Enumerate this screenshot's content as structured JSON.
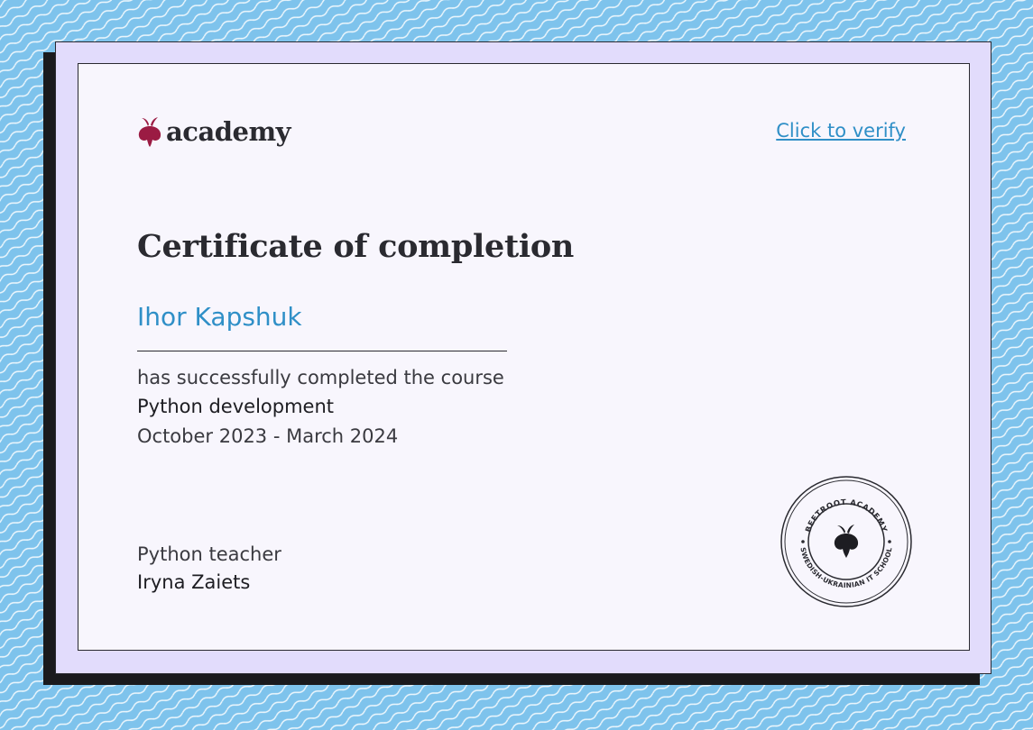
{
  "header": {
    "logo_text": "academy",
    "logo_icon": "beetroot-icon",
    "verify_link": "Click to verify"
  },
  "certificate": {
    "title": "Certificate of completion",
    "recipient_name": "Ihor Kapshuk",
    "completion_text": "has successfully completed the course",
    "course_name": "Python development",
    "course_dates": "October 2023 - March 2024",
    "teacher_role": "Python teacher",
    "teacher_name": "Iryna Zaiets"
  },
  "seal": {
    "top_text": "BEETROOT ACADEMY",
    "bottom_text": "SWEDISH-UKRAINIAN IT SCHOOL",
    "icon": "beetroot-icon"
  },
  "colors": {
    "background": "#7ec3ec",
    "outer_card": "#e2dcfc",
    "inner_card": "#f8f6fd",
    "accent_blue": "#2f8fc7",
    "brand_beet": "#9b1b43",
    "ink": "#2a2a30"
  }
}
